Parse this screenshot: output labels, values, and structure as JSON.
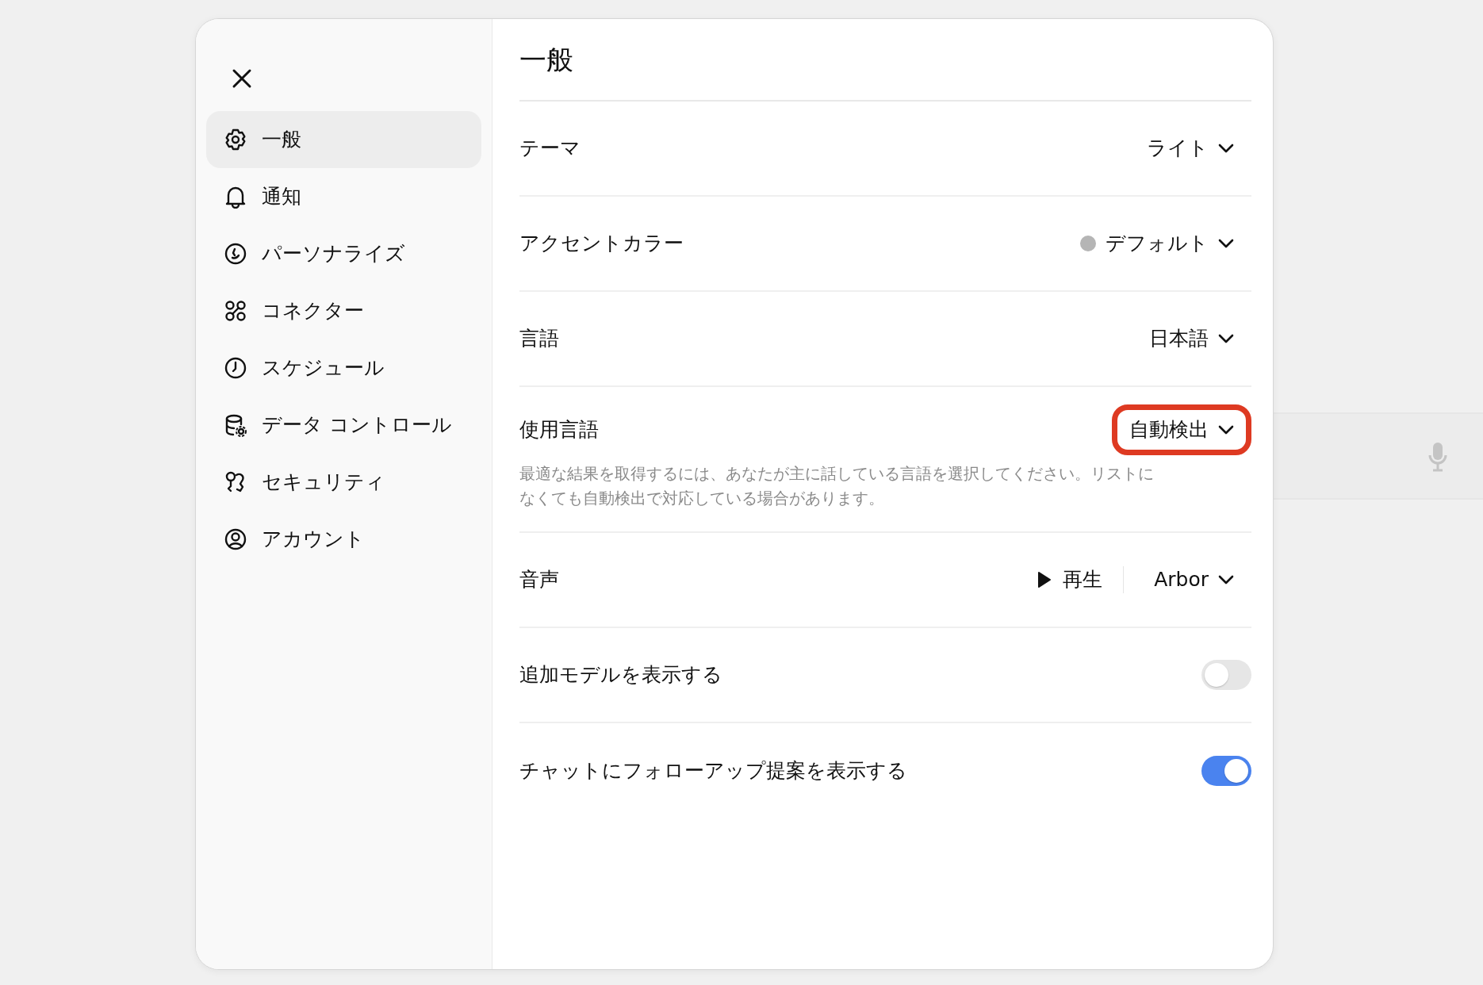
{
  "sidebar": {
    "items": [
      {
        "label": "一般",
        "selected": true
      },
      {
        "label": "通知",
        "selected": false
      },
      {
        "label": "パーソナライズ",
        "selected": false
      },
      {
        "label": "コネクター",
        "selected": false
      },
      {
        "label": "スケジュール",
        "selected": false
      },
      {
        "label": "データ コントロール",
        "selected": false
      },
      {
        "label": "セキュリティ",
        "selected": false
      },
      {
        "label": "アカウント",
        "selected": false
      }
    ]
  },
  "panel": {
    "title": "一般",
    "rows": [
      {
        "kind": "select",
        "label": "テーマ",
        "value": "ライト"
      },
      {
        "kind": "select",
        "label": "アクセントカラー",
        "value": "デフォルト",
        "color": "#b5b5b5"
      },
      {
        "kind": "select",
        "label": "言語",
        "value": "日本語"
      },
      {
        "kind": "select",
        "label": "使用言語",
        "value": "自動検出",
        "highlighted": true,
        "note": "最適な結果を取得するには、あなたが主に話している言語を選択してください。リストになくても自動検出で対応している場合があります。"
      },
      {
        "kind": "voice",
        "label": "音声",
        "play": "再生",
        "value": "Arbor"
      },
      {
        "kind": "toggle",
        "label": "追加モデルを表示する",
        "on": false
      },
      {
        "kind": "toggle",
        "label": "チャットにフォローアップ提案を表示する",
        "on": true
      }
    ]
  }
}
